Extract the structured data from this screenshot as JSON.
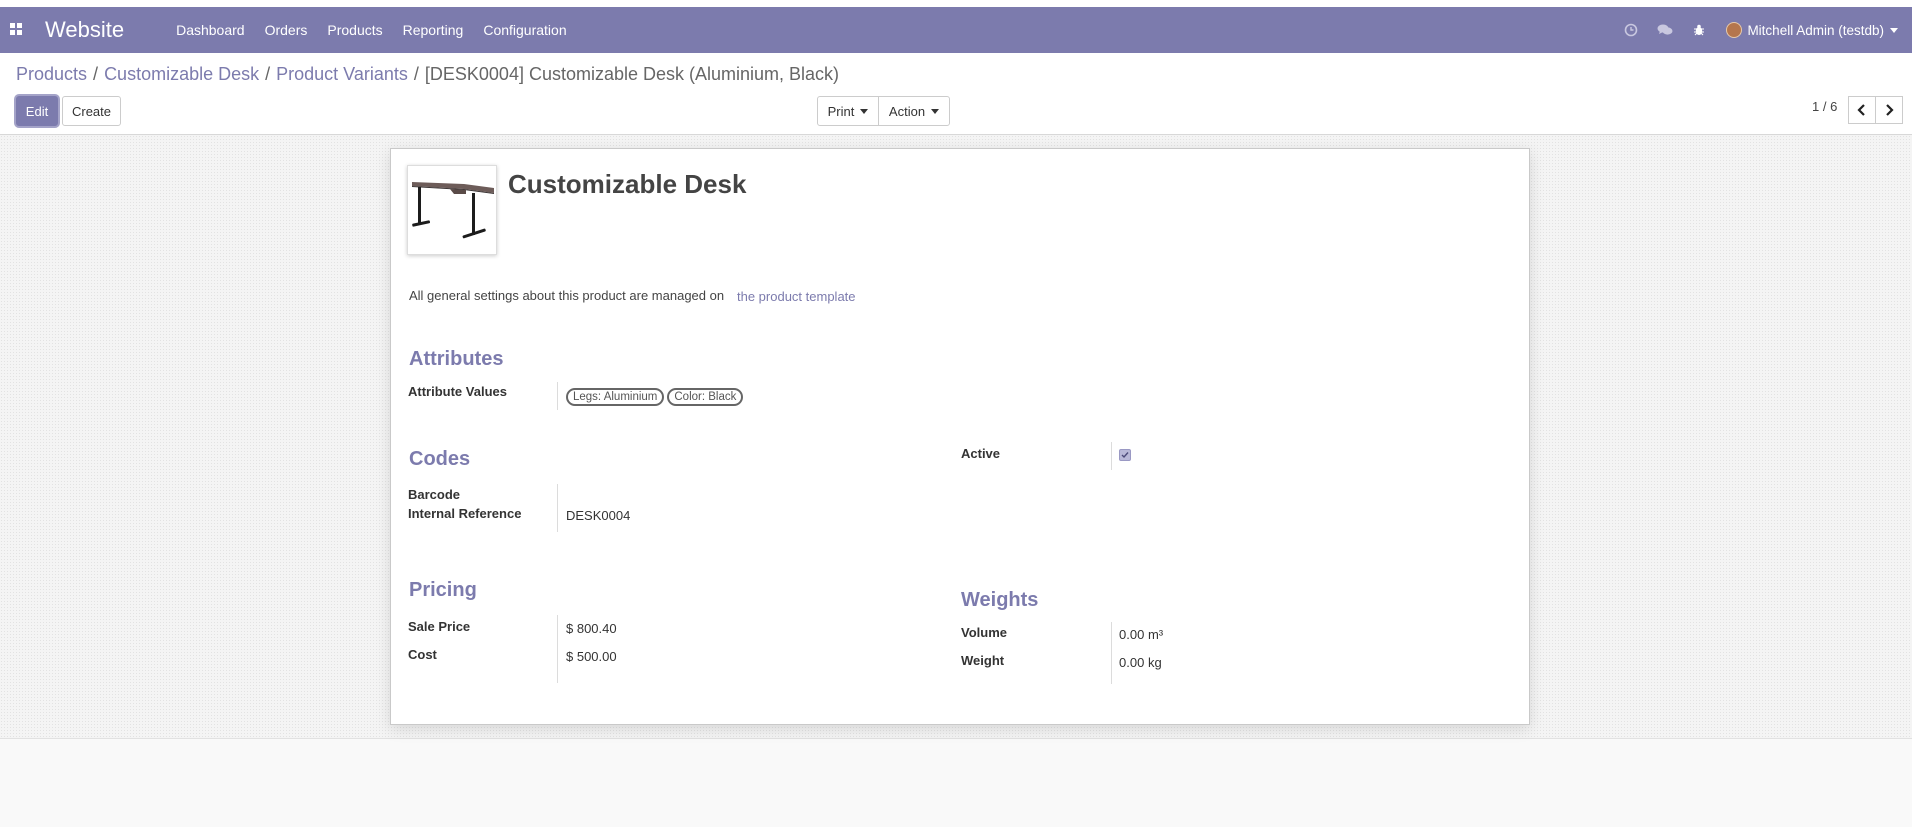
{
  "navbar": {
    "app_name": "Website",
    "menu": [
      "Dashboard",
      "Orders",
      "Products",
      "Reporting",
      "Configuration"
    ],
    "user_name": "Mitchell Admin (testdb)",
    "icons": [
      "apps-icon",
      "clock-icon",
      "chat-icon",
      "bug-icon"
    ],
    "bg_color": "#7c7bad"
  },
  "breadcrumb": {
    "items": [
      "Products",
      "Customizable Desk",
      "Product Variants"
    ],
    "current": "[DESK0004] Customizable Desk (Aluminium, Black)",
    "separator": "/"
  },
  "toolbar": {
    "edit_label": "Edit",
    "create_label": "Create",
    "print_label": "Print",
    "action_label": "Action"
  },
  "pager": {
    "value": "1 / 6"
  },
  "product": {
    "name": "Customizable Desk",
    "note": "All general settings about this product are managed on",
    "note_link": "the product template"
  },
  "attributes": {
    "title": "Attributes",
    "label": "Attribute Values",
    "tags": [
      "Legs: Aluminium",
      "Color: Black"
    ]
  },
  "codes": {
    "title": "Codes",
    "barcode_label": "Barcode",
    "barcode_value": "",
    "internal_ref_label": "Internal Reference",
    "internal_ref_value": "DESK0004"
  },
  "active": {
    "label": "Active",
    "checked": true
  },
  "pricing": {
    "title": "Pricing",
    "sale_price_label": "Sale Price",
    "sale_price_value": "$ 800.40",
    "cost_label": "Cost",
    "cost_value": "$ 500.00"
  },
  "weights": {
    "title": "Weights",
    "volume_label": "Volume",
    "volume_value": "0.00",
    "volume_unit": "m³",
    "weight_label": "Weight",
    "weight_value": "0.00",
    "weight_unit": "kg"
  }
}
